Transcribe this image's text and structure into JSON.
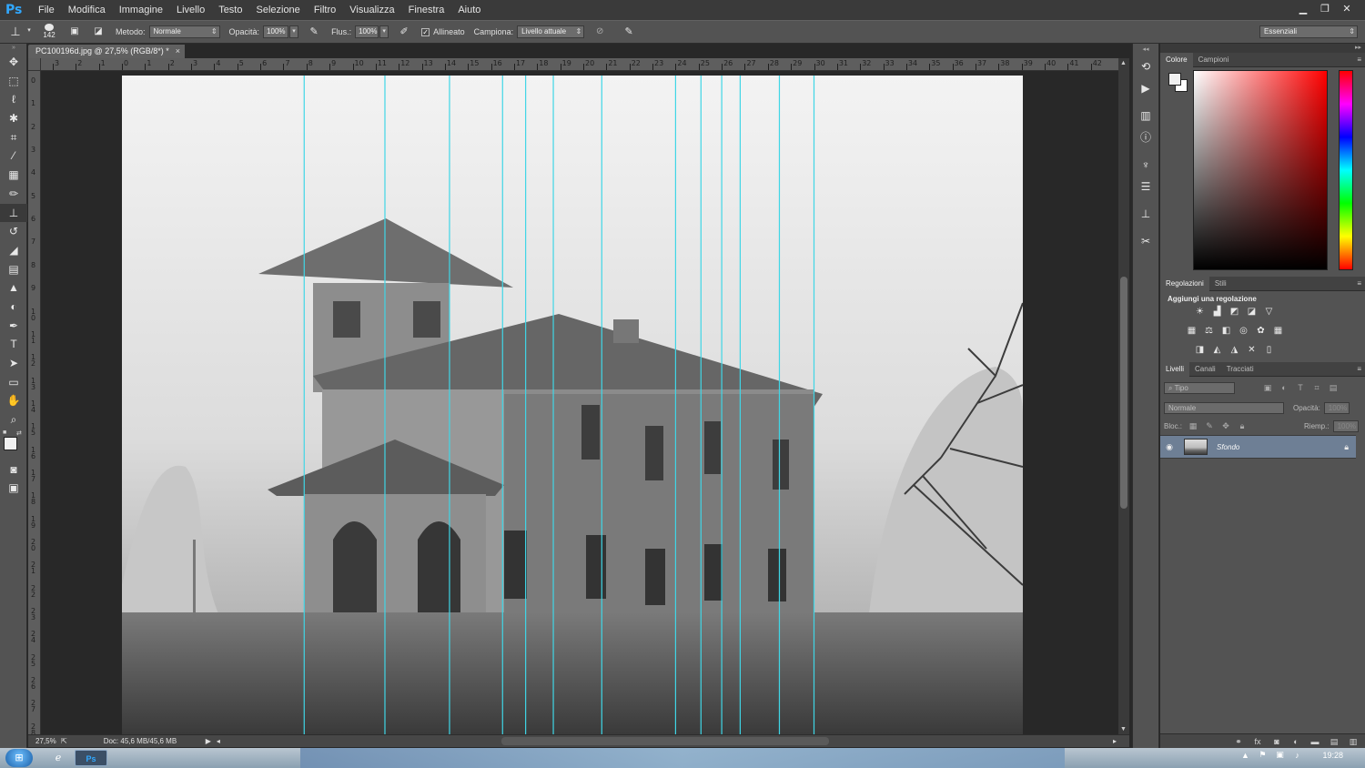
{
  "app": {
    "logo": "Ps"
  },
  "menu": [
    "File",
    "Modifica",
    "Immagine",
    "Livello",
    "Testo",
    "Selezione",
    "Filtro",
    "Visualizza",
    "Finestra",
    "Aiuto"
  ],
  "window_controls": {
    "minimize": "▁",
    "restore": "❐",
    "close": "✕"
  },
  "options": {
    "tool_icon": "clone-stamp-icon",
    "brush_size": "142",
    "metodo_label": "Metodo:",
    "metodo_value": "Normale",
    "opacita_label": "Opacità:",
    "opacita_value": "100%",
    "flusso_label": "Flus.:",
    "flusso_value": "100%",
    "allineato_label": "Allineato",
    "allineato_checked": true,
    "campiona_label": "Campiona:",
    "campiona_value": "Livello attuale",
    "workspace": "Essenziali"
  },
  "document": {
    "tab_title": "PC100196d.jpg @ 27,5% (RGB/8*) *",
    "tab_close": "×",
    "zoom": "27,5%",
    "doc_info": "Doc: 45,6 MB/45,6 MB",
    "h_ruler": [
      "3",
      "2",
      "1",
      "0",
      "1",
      "2",
      "3",
      "4",
      "5",
      "6",
      "7",
      "8",
      "9",
      "10",
      "11",
      "12",
      "13",
      "14",
      "15",
      "16",
      "17",
      "18",
      "19",
      "20",
      "21",
      "22",
      "23",
      "24",
      "25",
      "26",
      "27",
      "28",
      "29",
      "30",
      "31",
      "32",
      "33",
      "34",
      "35",
      "36",
      "37",
      "38",
      "39",
      "40",
      "41",
      "42"
    ],
    "v_ruler": [
      "0",
      "1",
      "2",
      "3",
      "4",
      "5",
      "6",
      "7",
      "8",
      "9",
      "10",
      "11",
      "12",
      "13",
      "14",
      "15",
      "16",
      "17",
      "18",
      "19",
      "20",
      "21",
      "22",
      "23",
      "24",
      "25",
      "26",
      "27",
      "28"
    ],
    "guides_x_cm": [
      7.9,
      11.4,
      14.2,
      16.5,
      17.5,
      18.7,
      20.8,
      24.0,
      25.1,
      26.0,
      26.8,
      28.5,
      30.0
    ]
  },
  "panels": {
    "color_tabs": [
      "Colore",
      "Campioni"
    ],
    "adjust_tabs": [
      "Regolazioni",
      "Stili"
    ],
    "adjust_title": "Aggiungi una regolazione",
    "layers_tabs": [
      "Livelli",
      "Canali",
      "Tracciati"
    ],
    "layers_filter": "Tipo",
    "layers_blend": "Normale",
    "layers_opacity_label": "Opacità:",
    "layers_opacity_value": "100%",
    "layers_lock_label": "Bloc.:",
    "layers_fill_label": "Riemp.:",
    "layers_fill_value": "100%",
    "layer_name": "Sfondo",
    "panel_menu": "≡"
  },
  "taskbar": {
    "clock": "19:28",
    "ps_label": "Ps"
  },
  "colors": {
    "accent": "#31a8ff",
    "guide": "#3fd6e6",
    "selected_layer": "#6e7f95"
  }
}
